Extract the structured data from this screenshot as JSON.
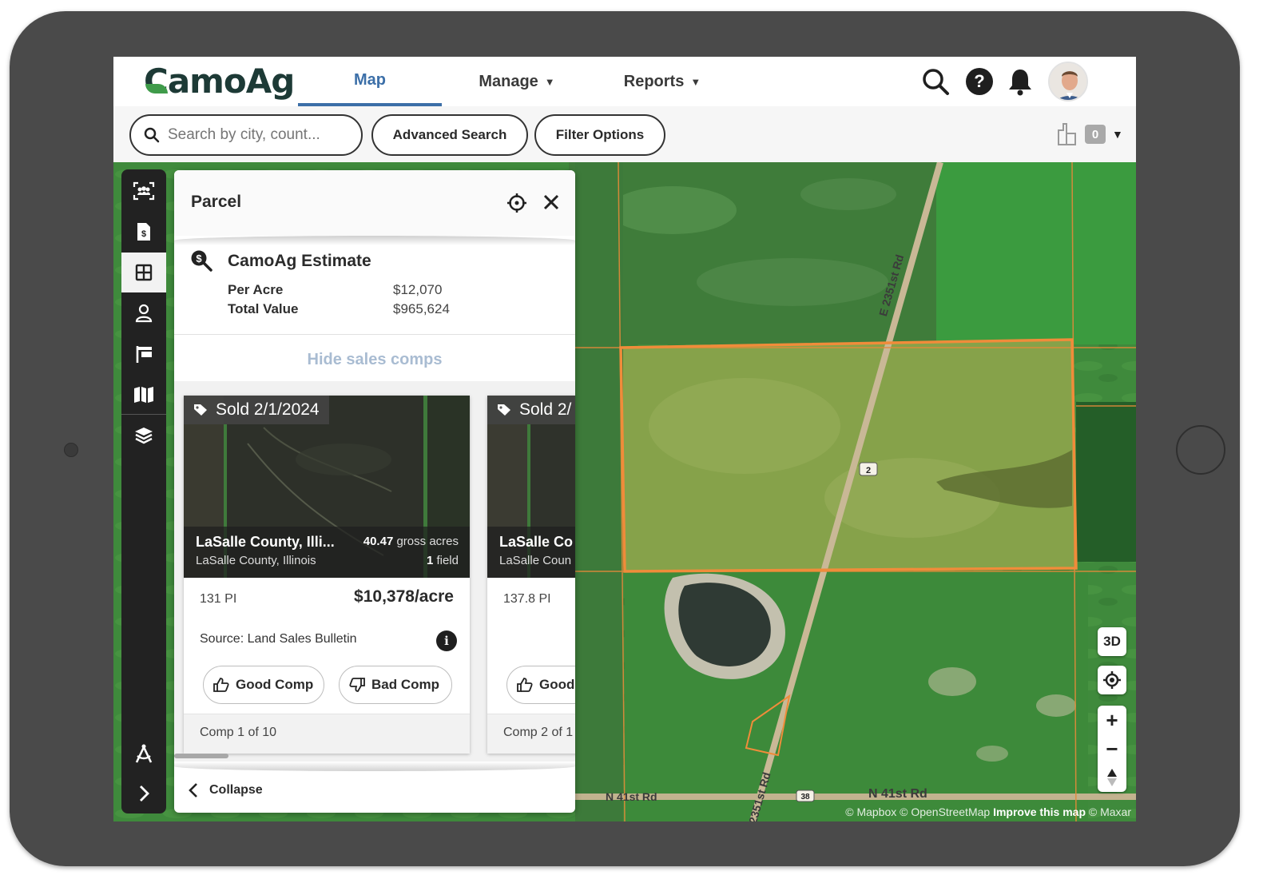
{
  "app": {
    "logo": "CamoAg"
  },
  "nav": {
    "items": [
      {
        "label": "Map",
        "active": true
      },
      {
        "label": "Manage",
        "has_dropdown": true
      },
      {
        "label": "Reports",
        "has_dropdown": true
      }
    ],
    "icons": [
      "search-icon",
      "help-icon",
      "bell-icon",
      "avatar"
    ]
  },
  "toolbar": {
    "search_placeholder": "Search by city, count...",
    "advanced_search": "Advanced Search",
    "filter_options": "Filter Options",
    "compare_count": "0"
  },
  "rail": {
    "items": [
      "people-scan-icon",
      "invoice-icon",
      "grid-icon",
      "user-icon",
      "flag-icon",
      "map-icon",
      "layers-icon",
      "drafting-compass-icon",
      "chevron-right-icon"
    ],
    "active_index": 2
  },
  "panel": {
    "title": "Parcel",
    "estimate": {
      "title": "CamoAg Estimate",
      "rows": [
        {
          "label": "Per Acre",
          "value": "$12,070"
        },
        {
          "label": "Total Value",
          "value": "$965,624"
        }
      ]
    },
    "hide_comps": "Hide sales comps",
    "comps": [
      {
        "sold": "Sold 2/1/2024",
        "name": "LaSalle County, Illi...",
        "location": "LaSalle County, Illinois",
        "acres_num": "40.47",
        "acres_label": "gross acres",
        "fields_num": "1",
        "fields_label": "field",
        "pi": "131 PI",
        "price": "$10,378/acre",
        "source": "Source: Land Sales Bulletin",
        "good": "Good Comp",
        "bad": "Bad Comp",
        "footer": "Comp 1 of 10"
      },
      {
        "sold": "Sold 2/",
        "name": "LaSalle Co",
        "location": "LaSalle Coun",
        "pi": "137.8 PI",
        "good": "Good",
        "footer": "Comp 2 of 1"
      }
    ],
    "collapse": "Collapse"
  },
  "map": {
    "roads": [
      "E 2351st Rd",
      "N 41st Rd",
      "N 41st Rd",
      "2351st Rd"
    ],
    "shields": [
      "2",
      "38"
    ],
    "attribution": {
      "text": "© Mapbox © OpenStreetMap",
      "link": "Improve this map",
      "tail": "© Maxar"
    },
    "controls": {
      "3d": "3D"
    }
  },
  "colors": {
    "brand_dark": "#1d3a36",
    "nav_active": "#3c6fa8",
    "parcel_outline": "#f08c3a"
  }
}
